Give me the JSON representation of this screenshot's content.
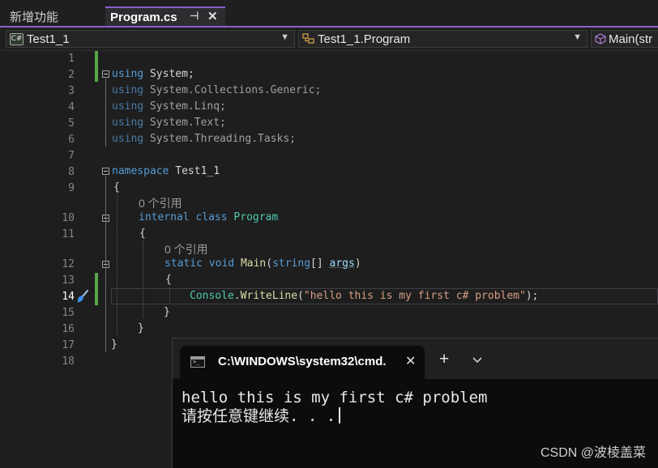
{
  "tabs": {
    "inactive_label": "新增功能",
    "active_label": "Program.cs",
    "pin_glyph": "⊣",
    "close_glyph": "✕"
  },
  "navbar": {
    "project": "Test1_1",
    "project_icon": "C#",
    "class": "Test1_1.Program",
    "member": "Main(str"
  },
  "editor": {
    "line_numbers": [
      "1",
      "2",
      "3",
      "4",
      "5",
      "6",
      "7",
      "8",
      "9",
      "10",
      "11",
      "12",
      "13",
      "14",
      "15",
      "16",
      "17",
      "18"
    ],
    "active_line": "14",
    "using_kw": "using",
    "usings": [
      "System;",
      "System.Collections.Generic;",
      "System.Linq;",
      "System.Text;",
      "System.Threading.Tasks;"
    ],
    "namespace_kw": "namespace",
    "namespace_name": "Test1_1",
    "open_brace": "{",
    "close_brace": "}",
    "refs_label": "0 个引用",
    "internal_kw": "internal",
    "class_kw": "class",
    "class_name": "Program",
    "static_kw": "static",
    "void_kw": "void",
    "main_name": "Main",
    "string_kw": "string",
    "array_suffix": "[]",
    "args_name": "args",
    "paren_open": "(",
    "paren_close": ")",
    "console_type": "Console",
    "dot": ".",
    "writeline": "WriteLine",
    "literal": "\"hello this is my first c# problem\"",
    "stmt_end": ");"
  },
  "console": {
    "tab_title": "C:\\WINDOWS\\system32\\cmd.",
    "output_line1": "hello this is my first c# problem",
    "output_line2": "请按任意键继续. . .",
    "plus_glyph": "+",
    "dropdown_glyph": "⌄"
  },
  "watermark": "CSDN @波棱盖菜"
}
